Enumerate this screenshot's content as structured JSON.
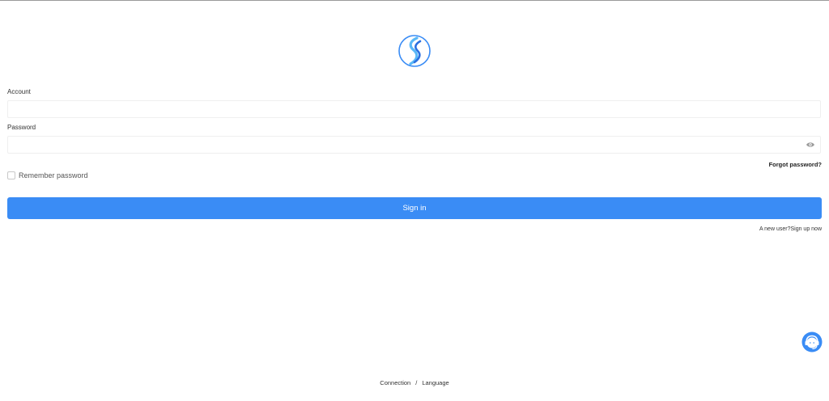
{
  "login": {
    "account_label": "Account",
    "account_value": "",
    "password_label": "Password",
    "password_value": "",
    "forgot_label": "Forgot password?",
    "remember_label": "Remember password",
    "remember_checked": false,
    "signin_label": "Sign in",
    "signup_prompt": "A new user?",
    "signup_link": "Sign up now"
  },
  "footer": {
    "connection_label": "Connection",
    "separator": "/",
    "language_label": "Language"
  },
  "icons": {
    "logo": "s-wave-logo",
    "password_toggle": "eye-icon",
    "support": "headset-icon"
  },
  "colors": {
    "primary": "#3a8cf5",
    "logo_light": "#5ab8f7",
    "logo_dark": "#2a6fe0"
  }
}
